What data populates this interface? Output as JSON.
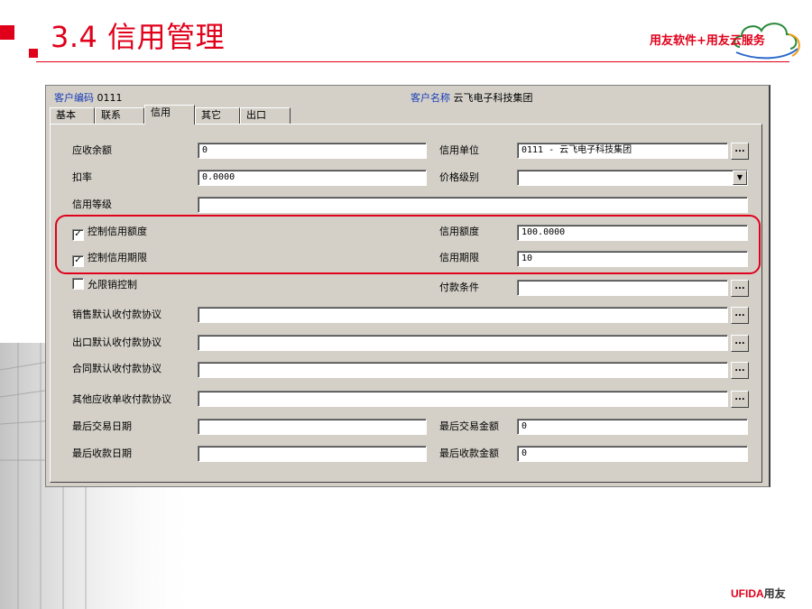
{
  "slide": {
    "title": "3.4 信用管理",
    "brand": "用友软件+用友云服务",
    "footer_logo_en": "UFIDA",
    "footer_logo_cn": "用友"
  },
  "header": {
    "code_label": "客户编码",
    "code_value": "0111",
    "name_label": "客户名称",
    "name_value": "云飞电子科技集团"
  },
  "tabs": [
    "基本",
    "联系",
    "信用",
    "其它",
    "出口"
  ],
  "active_tab": "信用",
  "fields": {
    "receivable_balance": {
      "label": "应收余额",
      "value": "0"
    },
    "credit_unit": {
      "label": "信用单位",
      "value": "0111 - 云飞电子科技集团",
      "button": "..."
    },
    "discount_rate": {
      "label": "扣率",
      "value": "0.0000"
    },
    "price_level": {
      "label": "价格级别",
      "value": "",
      "dropdown": "▼"
    },
    "credit_grade": {
      "label": "信用等级",
      "value": ""
    },
    "control_credit_limit": {
      "label": "控制信用额度",
      "checked": true
    },
    "credit_limit": {
      "label": "信用额度",
      "value": "100.0000"
    },
    "control_credit_period": {
      "label": "控制信用期限",
      "checked": true
    },
    "credit_period": {
      "label": "信用期限",
      "value": "10"
    },
    "limit_sales_control": {
      "label": "允限销控制",
      "checked": false
    },
    "payment_terms": {
      "label": "付款条件",
      "value": "",
      "button": "..."
    },
    "sales_default_agreement": {
      "label": "销售默认收付款协议",
      "value": "",
      "button": "..."
    },
    "export_default_agreement": {
      "label": "出口默认收付款协议",
      "value": "",
      "button": "..."
    },
    "contract_default_agreement": {
      "label": "合同默认收付款协议",
      "value": "",
      "button": "..."
    },
    "other_receivable_agreement": {
      "label": "其他应收单收付款协议",
      "value": "",
      "button": "..."
    },
    "last_trade_date": {
      "label": "最后交易日期",
      "value": ""
    },
    "last_trade_amount": {
      "label": "最后交易金额",
      "value": "0"
    },
    "last_receipt_date": {
      "label": "最后收款日期",
      "value": ""
    },
    "last_receipt_amount": {
      "label": "最后收款金额",
      "value": "0"
    }
  },
  "colors": {
    "accent": "#e0001a",
    "dialog_bg": "#d4d0c8",
    "label_blue": "#1a3db8"
  }
}
